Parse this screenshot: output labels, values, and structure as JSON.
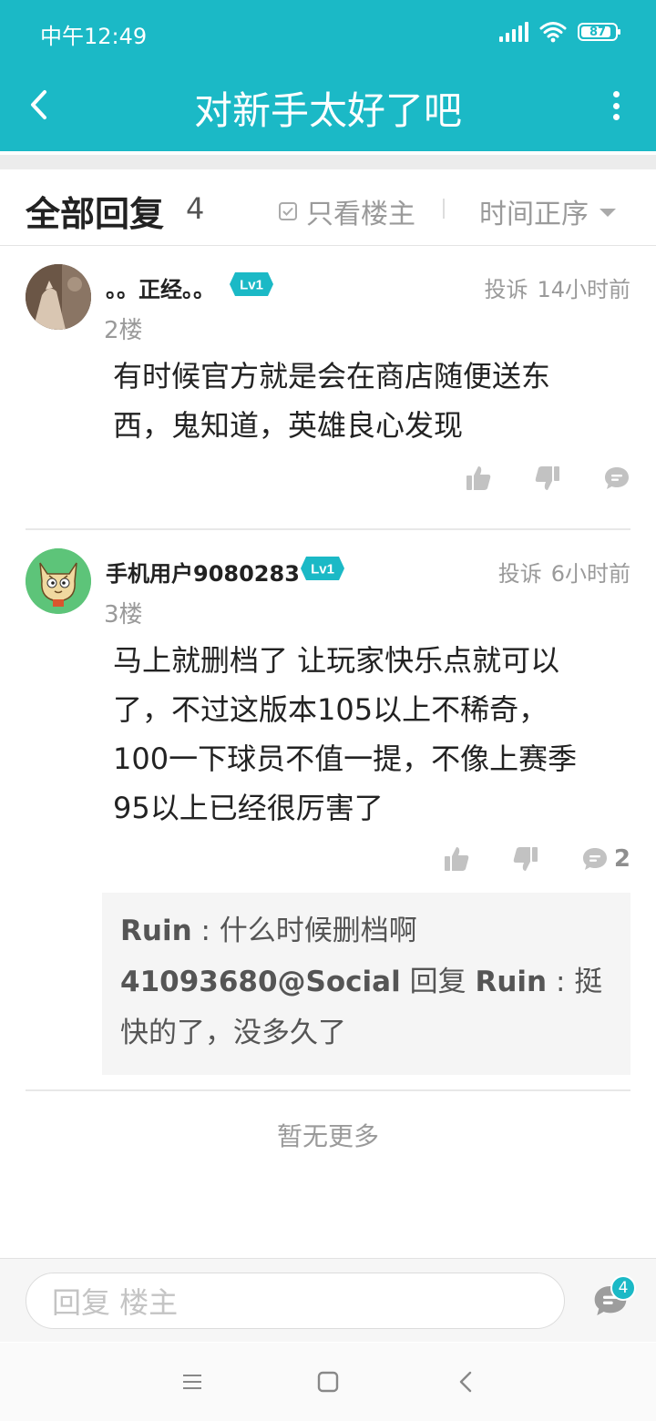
{
  "status_bar": {
    "time": "中午12:49",
    "battery": "87"
  },
  "nav": {
    "title": "对新手太好了吧"
  },
  "replies_header": {
    "title": "全部回复",
    "count": "4",
    "only_owner_label": "只看楼主",
    "sort_label": "时间正序"
  },
  "replies": [
    {
      "username": "。。正经。。",
      "level": "Lv1",
      "report_label": "投诉",
      "time": "14小时前",
      "floor": "2楼",
      "content_lines": [
        "有时候官方就是会在商店随便送东",
        "西，鬼知道，英雄良心发现"
      ]
    },
    {
      "username": "手机用户9080283",
      "level": "Lv1",
      "report_label": "投诉",
      "time": "6小时前",
      "floor": "3楼",
      "content_lines": [
        "马上就删档了 让玩家快乐点就可以",
        "了，不过这版本105以上不稀奇，",
        "100一下球员不值一提，不像上赛季",
        "95以上已经很厉害了"
      ],
      "comment_count": "2",
      "sub_replies": [
        {
          "name": "Ruin",
          "sep": " : ",
          "text": "什么时候删档啊"
        },
        {
          "name": "41093680@Social",
          "reply_word": " 回复 ",
          "target": "Ruin",
          "sep": " : ",
          "text": "挺快的了，没多久了"
        }
      ]
    }
  ],
  "footer": {
    "no_more": "暂无更多"
  },
  "reply_bar": {
    "placeholder": "回复  楼主",
    "badge": "4"
  },
  "colors": {
    "accent": "#1bb9c6",
    "text": "#222222",
    "muted": "#9a9a9a"
  }
}
